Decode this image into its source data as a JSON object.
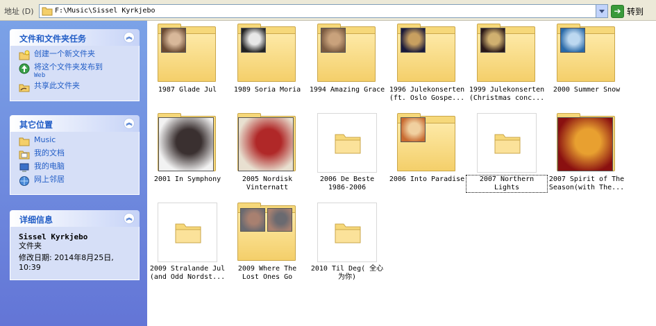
{
  "addressbar": {
    "label": "地址 (D)",
    "path": "F:\\Music\\Sissel Kyrkjebo",
    "go_label": "转到"
  },
  "taskpane": {
    "file_tasks": {
      "title": "文件和文件夹任务",
      "items": [
        {
          "label": "创建一个新文件夹",
          "sub": "",
          "icon": "new-folder-icon"
        },
        {
          "label": "将这个文件夹发布到",
          "sub": "Web",
          "icon": "publish-web-icon"
        },
        {
          "label": "共享此文件夹",
          "sub": "",
          "icon": "share-folder-icon"
        }
      ]
    },
    "other_places": {
      "title": "其它位置",
      "items": [
        {
          "label": "Music",
          "icon": "folder-icon"
        },
        {
          "label": "我的文档",
          "icon": "my-documents-icon"
        },
        {
          "label": "我的电脑",
          "icon": "my-computer-icon"
        },
        {
          "label": "网上邻居",
          "icon": "network-icon"
        }
      ]
    },
    "details": {
      "title": "详细信息",
      "name": "Sissel Kyrkjebo",
      "type": "文件夹",
      "modified": "修改日期: 2014年8月25日,",
      "time": "10:39"
    }
  },
  "folders": [
    {
      "line1": "1987 Glade Jul",
      "line2": "",
      "style": "small",
      "colors": [
        "#6b4a32",
        "#d8b89a"
      ],
      "selected": false
    },
    {
      "line1": "1989 Soria Moria",
      "line2": "",
      "style": "small",
      "colors": [
        "#222222",
        "#e8e8e8"
      ],
      "selected": false
    },
    {
      "line1": "1994 Amazing Grace",
      "line2": "",
      "style": "small",
      "colors": [
        "#7a5a40",
        "#c9a27c"
      ],
      "selected": false
    },
    {
      "line1": "1996 Julekonserten",
      "line2": "(ft. Oslo Gospe...",
      "style": "small",
      "colors": [
        "#1a1a3a",
        "#c8a060"
      ],
      "selected": false
    },
    {
      "line1": "1999 Julekonserten",
      "line2": "(Christmas conc...",
      "style": "small",
      "colors": [
        "#2a1818",
        "#d0b070"
      ],
      "selected": false
    },
    {
      "line1": "2000 Summer Snow",
      "line2": "",
      "style": "small",
      "colors": [
        "#2a6aa8",
        "#bcd8f0"
      ],
      "selected": false
    },
    {
      "line1": "2001 In Symphony",
      "line2": "",
      "style": "big",
      "colors": [
        "#f2f2f2",
        "#3a3030"
      ],
      "selected": false
    },
    {
      "line1": "2005 Nordisk",
      "line2": "Vinternatt",
      "style": "big",
      "colors": [
        "#e8e0d0",
        "#b02828"
      ],
      "selected": false
    },
    {
      "line1": "2006 De Beste",
      "line2": "1986-2006",
      "style": "empty",
      "colors": [],
      "selected": false
    },
    {
      "line1": "2006 Into Paradise",
      "line2": "",
      "style": "small",
      "colors": [
        "#c86a30",
        "#f0d0a0"
      ],
      "selected": false
    },
    {
      "line1": "2007 Northern",
      "line2": "Lights",
      "style": "empty",
      "colors": [],
      "selected": true
    },
    {
      "line1": "2007 Spirit of The",
      "line2": "Season(with The...",
      "style": "big",
      "colors": [
        "#8a1010",
        "#e8a030"
      ],
      "selected": false
    },
    {
      "line1": "2009 Stralande Jul",
      "line2": "(and Odd Nordst...",
      "style": "empty",
      "colors": [],
      "selected": false
    },
    {
      "line1": "2009 Where The",
      "line2": "Lost Ones Go",
      "style": "double",
      "colors": [
        "#6a6a70",
        "#a88070"
      ],
      "selected": false
    },
    {
      "line1": "2010 Til Deg( 全心",
      "line2": "为你)",
      "style": "empty",
      "colors": [],
      "selected": false
    }
  ]
}
